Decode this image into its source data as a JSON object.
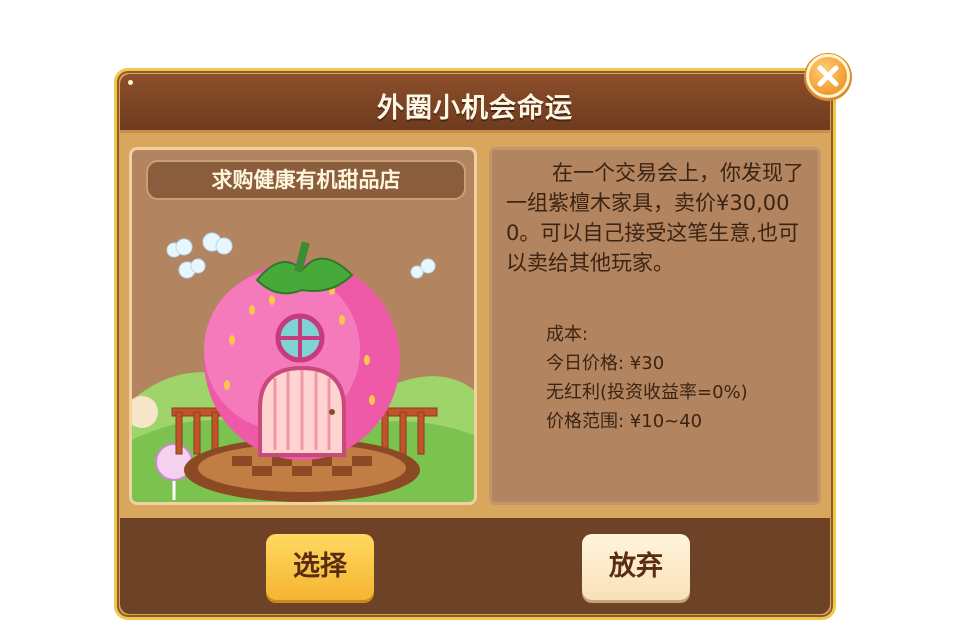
{
  "dialog": {
    "title": "外圈小机会命运",
    "close_icon": "close-icon"
  },
  "card": {
    "title": "求购健康有机甜品店",
    "image": "strawberry-house-illustration"
  },
  "description": "在一个交易会上，你发现了一组紫檀木家具，卖价¥30,000。可以自己接受这笔生意,也可以卖给其他玩家。",
  "stats": {
    "cost": "成本:",
    "price_today": "今日价格: ¥30",
    "dividend": "无红利(投资收益率=0%)",
    "price_range": "价格范围: ¥10~40"
  },
  "buttons": {
    "select": "选择",
    "abandon": "放弃"
  },
  "colors": {
    "header": "#7c4424",
    "panel": "#b28460",
    "select_button": "#f8c240",
    "abandon_button": "#fbe9c9"
  }
}
